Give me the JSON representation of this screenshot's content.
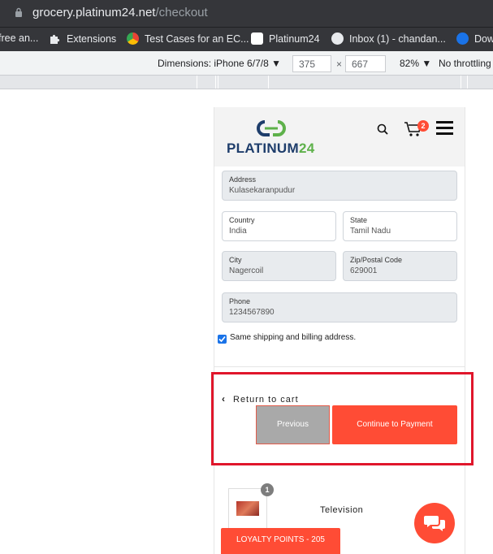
{
  "browser": {
    "url_host": "grocery.platinum24.net",
    "url_path": "/checkout",
    "bookmarks": [
      {
        "label": "free an...",
        "icon": "bookmark-icon"
      },
      {
        "label": "Extensions",
        "icon": "puzzle-icon"
      },
      {
        "label": "Test Cases for an EC...",
        "icon": "chrome-icon"
      },
      {
        "label": "Platinum24",
        "icon": "platinum24-icon"
      },
      {
        "label": "Inbox (1) - chandan...",
        "icon": "gear-icon"
      },
      {
        "label": "Dow",
        "icon": "play-icon"
      }
    ]
  },
  "devtools": {
    "dimensions_label": "Dimensions: iPhone 6/7/8",
    "width": "375",
    "times": "×",
    "height": "667",
    "zoom": "82%",
    "throttle": "No throttling"
  },
  "header": {
    "logo_text": "PLATINUM",
    "logo_num": "24",
    "cart_count": "2"
  },
  "form": {
    "address_label": "Address",
    "address_value": "Kulasekaranpudur",
    "country_label": "Country",
    "country_value": "India",
    "state_label": "State",
    "state_value": "Tamil Nadu",
    "city_label": "City",
    "city_value": "Nagercoil",
    "zip_label": "Zip/Postal Code",
    "zip_value": "629001",
    "phone_label": "Phone",
    "phone_value": "1234567890",
    "same_address_label": "Same shipping and billing address."
  },
  "actions": {
    "return_label": "Return to cart",
    "previous_label": "Previous",
    "continue_label": "Continue to Payment"
  },
  "product": {
    "qty": "1",
    "name": "Television"
  },
  "loyalty": {
    "label": "LOYALTY POINTS - 205"
  },
  "colors": {
    "accent": "#ff4c35",
    "highlight": "#e0162b",
    "brand_navy": "#1e3d6b",
    "brand_green": "#5eb14a"
  }
}
